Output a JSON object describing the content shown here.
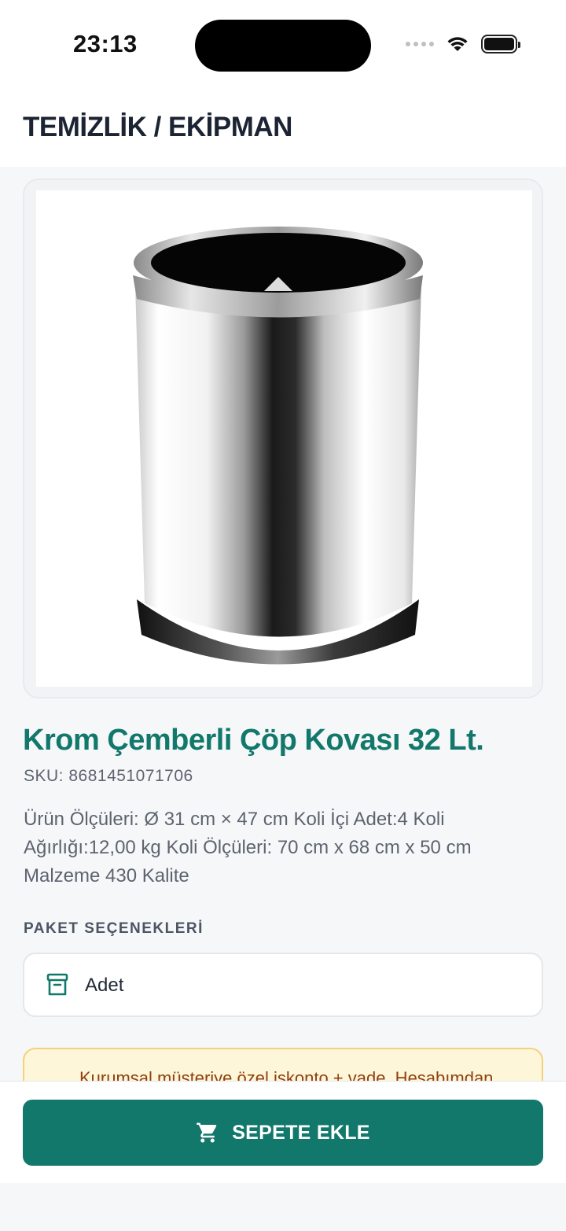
{
  "status_bar": {
    "time": "23:13"
  },
  "header": {
    "title": "TEMİZLİK / EKİPMAN"
  },
  "product": {
    "image_icon": "chrome-trash-bin-image",
    "title": "Krom Çemberli Çöp Kovası 32 Lt.",
    "sku": "SKU: 8681451071706",
    "description": "Ürün Ölçüleri: Ø 31 cm × 47 cm Koli İçi Adet:4 Koli Ağırlığı:12,00 kg Koli Ölçüleri: 70 cm x 68 cm x 50 cm Malzeme 430 Kalite"
  },
  "package_options": {
    "label": "PAKET SEÇENEKLERİ",
    "selected": {
      "icon": "archive-box-icon",
      "label": "Adet"
    }
  },
  "notice": {
    "text": "Kurumsal müşteriye özel iskonto + vade. Hesabımdan"
  },
  "cart": {
    "button_label": "SEPETE EKLE",
    "icon": "shopping-cart-icon"
  },
  "colors": {
    "brand": "#12786b",
    "notice_bg": "#fdf6d9",
    "notice_border": "#f3d27a"
  }
}
